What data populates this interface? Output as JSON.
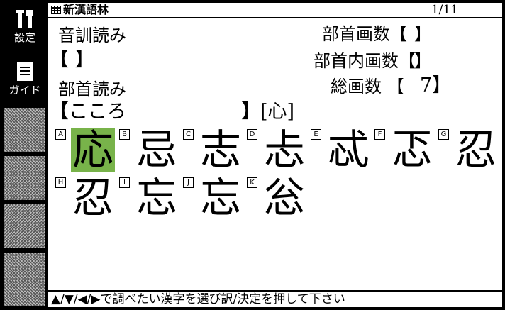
{
  "sidebar": {
    "settings_label": "設定",
    "guide_label": "ガイド",
    "settings_icon": "tools-icon",
    "guide_icon": "document-icon"
  },
  "title_bar": {
    "title": "新漢語林",
    "page": "1/11"
  },
  "fields": {
    "onkun_label": "音訓読み",
    "onkun_value": "【                              】",
    "bushu_yomi_label": "部首読み",
    "bushu_yomi_value": "【こころ",
    "bushu_yomi_close": "】[心]",
    "bushu_kakusu_label": "部首画数【",
    "bushu_kakusu_value": "    】",
    "bushunai_kakusu_label": "部首内画数【",
    "bushunai_kakusu_value": "    】",
    "sou_kakusu_label": "総画数 【",
    "sou_kakusu_value": "7】"
  },
  "results": [
    {
      "key": "A",
      "kanji": "応",
      "selected": true
    },
    {
      "key": "B",
      "kanji": "忌",
      "selected": false
    },
    {
      "key": "C",
      "kanji": "志",
      "selected": false
    },
    {
      "key": "D",
      "kanji": "忐",
      "selected": false
    },
    {
      "key": "E",
      "kanji": "忒",
      "selected": false
    },
    {
      "key": "F",
      "kanji": "忑",
      "selected": false
    },
    {
      "key": "G",
      "kanji": "忍",
      "selected": false
    },
    {
      "key": "H",
      "kanji": "忍",
      "selected": false
    },
    {
      "key": "I",
      "kanji": "忘",
      "selected": false
    },
    {
      "key": "J",
      "kanji": "忘",
      "selected": false
    },
    {
      "key": "K",
      "kanji": "忩",
      "selected": false
    }
  ],
  "footer": {
    "hint": "▲/▼/◀/▶で調べたい漢字を選び訳/決定を押して下さい"
  },
  "colors": {
    "selection": "#78b34a"
  }
}
